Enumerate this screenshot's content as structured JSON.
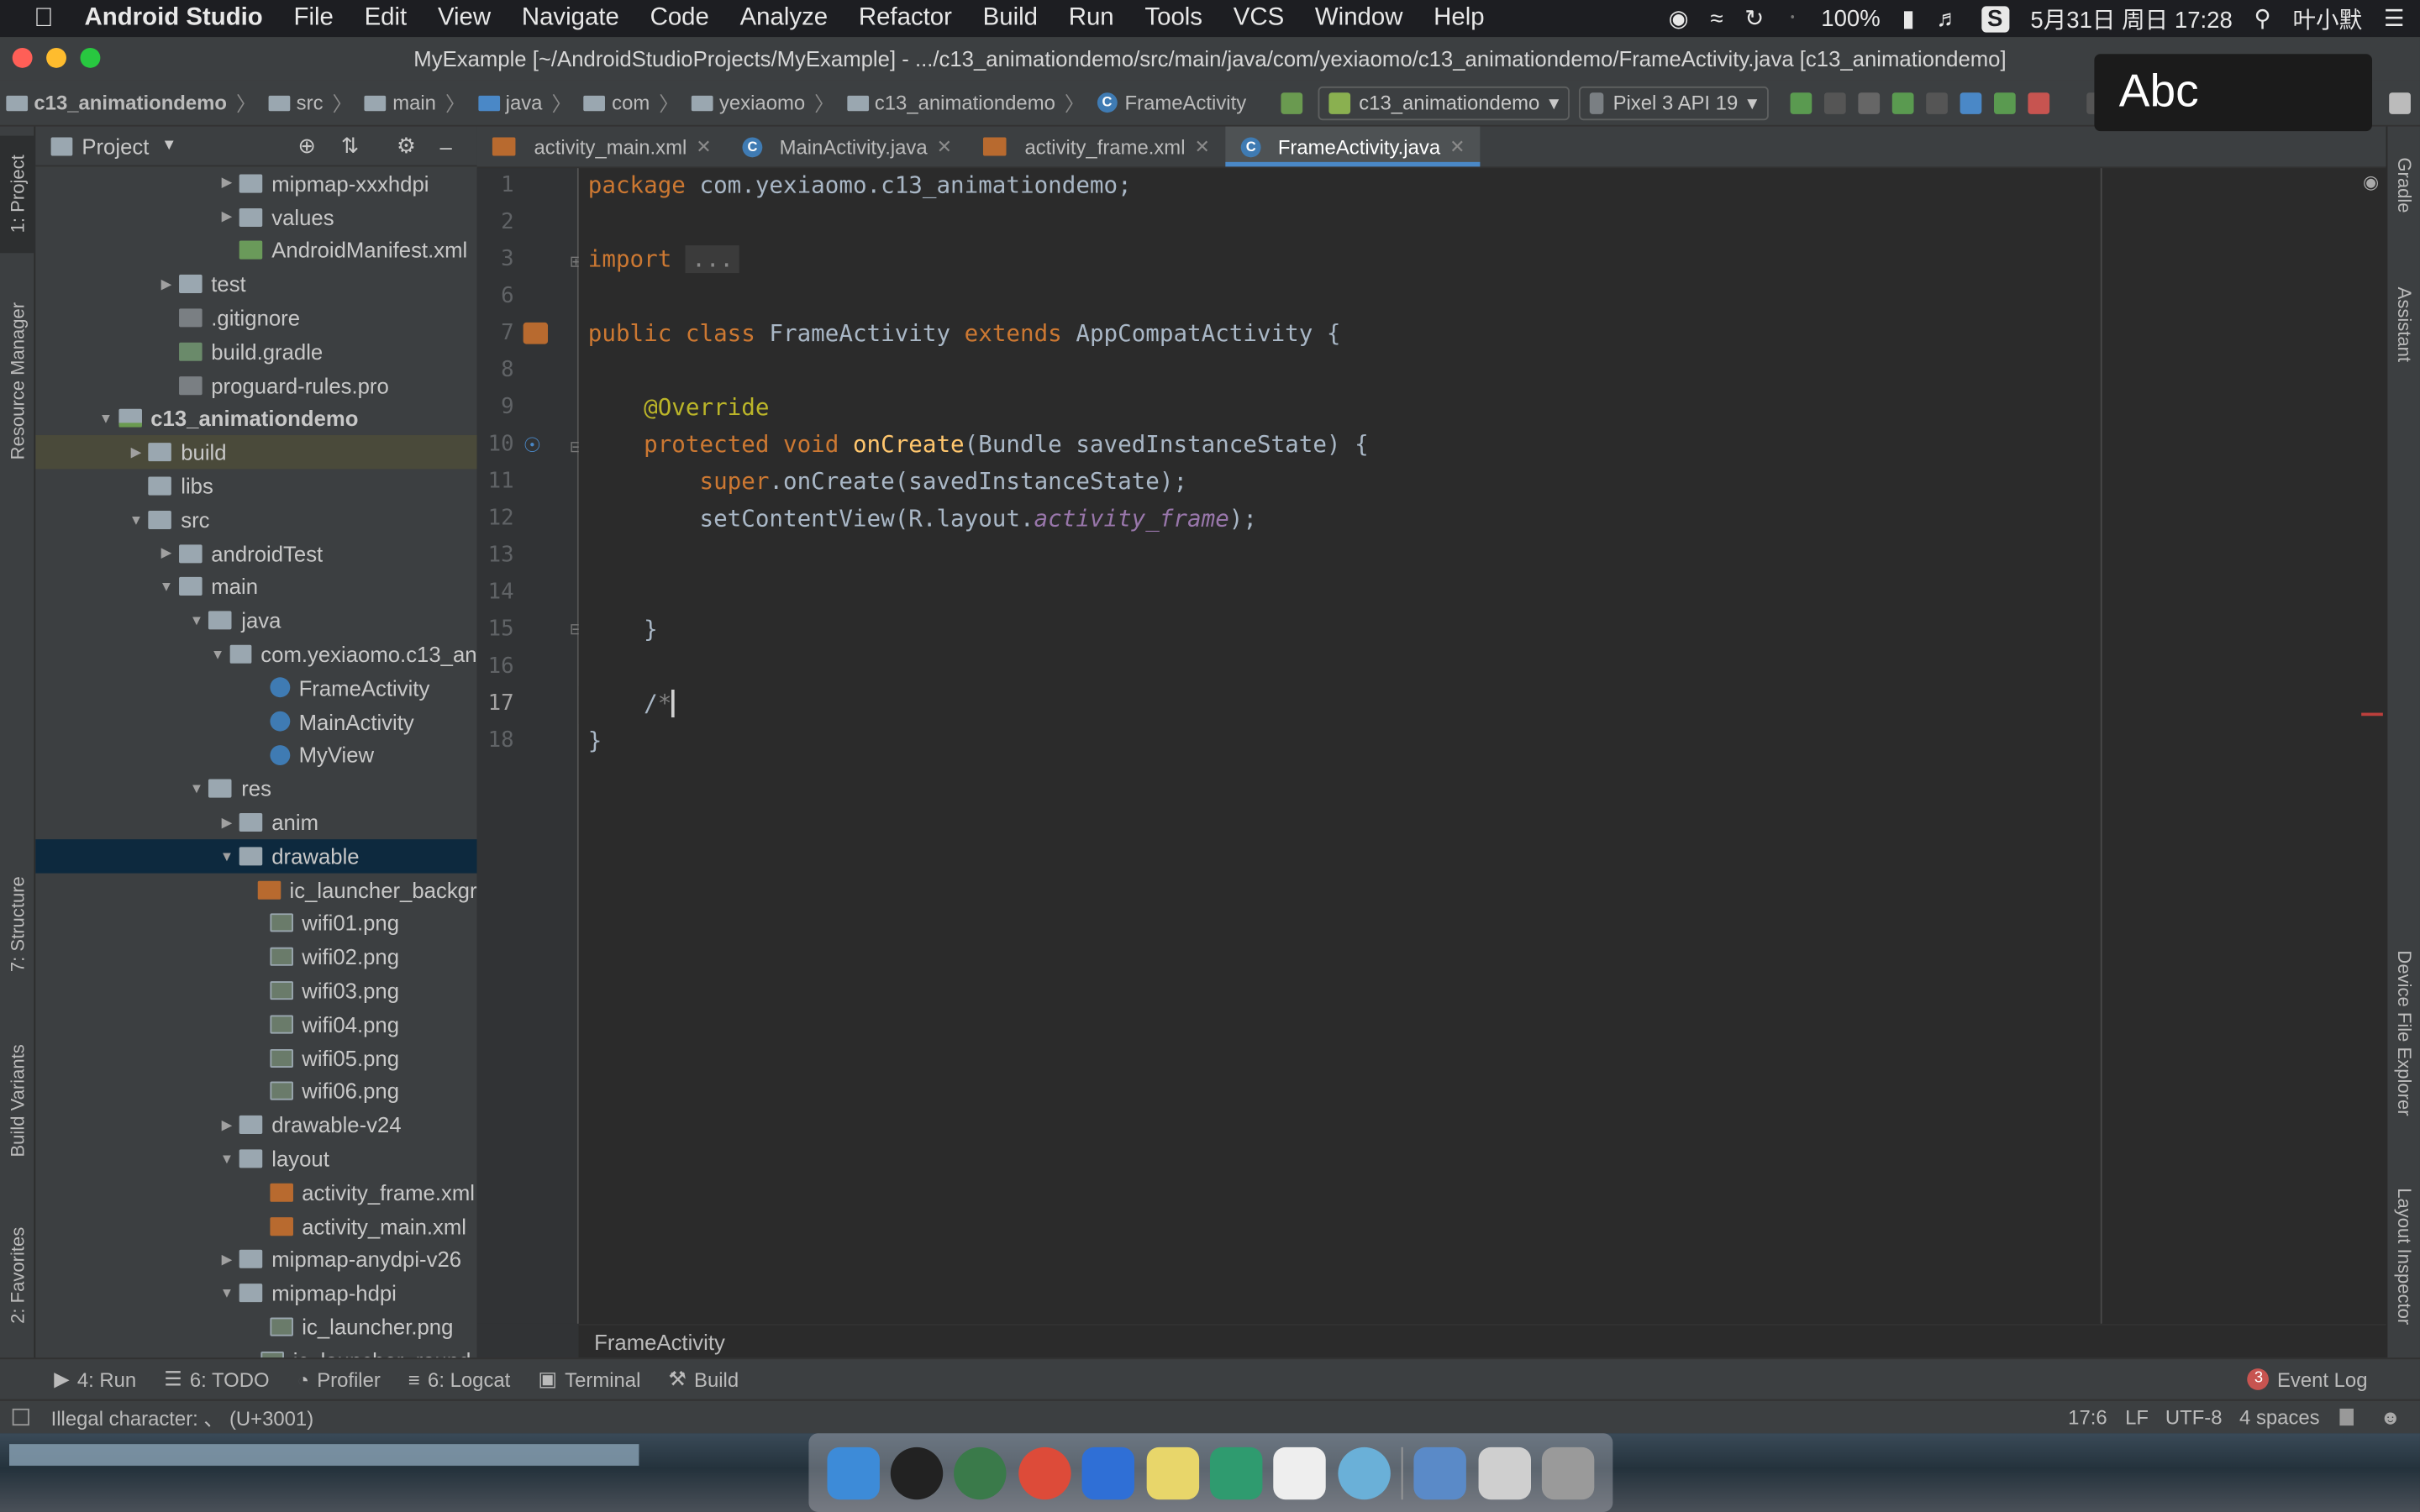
{
  "menubar": {
    "apple": "",
    "app": "Android Studio",
    "items": [
      "File",
      "Edit",
      "View",
      "Navigate",
      "Code",
      "Analyze",
      "Refactor",
      "Build",
      "Run",
      "Tools",
      "VCS",
      "Window",
      "Help"
    ],
    "battery": "100%",
    "datetime": "5月31日 周日 17:28",
    "user": "叶小默"
  },
  "window": {
    "title": "MyExample [~/AndroidStudioProjects/MyExample] - .../c13_animationdemo/src/main/java/com/yexiaomo/c13_animationdemo/FrameActivity.java [c13_animationdemo]"
  },
  "navbar": {
    "crumbs": [
      "c13_animationdemo",
      "src",
      "main",
      "java",
      "com",
      "yexiaomo",
      "c13_animationdemo",
      "FrameActivity"
    ],
    "run_config": "c13_animationdemo",
    "device": "Pixel 3 API 19"
  },
  "project_panel": {
    "title": "Project",
    "rows": [
      {
        "label": "mipmap-xxxhdpi",
        "indent": 5,
        "arrow": "right",
        "icon": "folder"
      },
      {
        "label": "values",
        "indent": 5,
        "arrow": "right",
        "icon": "folder"
      },
      {
        "label": "AndroidManifest.xml",
        "indent": 5,
        "arrow": "",
        "icon": "manifest"
      },
      {
        "label": "test",
        "indent": 3,
        "arrow": "right",
        "icon": "folder"
      },
      {
        "label": ".gitignore",
        "indent": 3,
        "arrow": "",
        "icon": "file"
      },
      {
        "label": "build.gradle",
        "indent": 3,
        "arrow": "",
        "icon": "gradle"
      },
      {
        "label": "proguard-rules.pro",
        "indent": 3,
        "arrow": "",
        "icon": "file"
      },
      {
        "label": "c13_animationdemo",
        "indent": 1,
        "arrow": "down",
        "icon": "modfolder",
        "bold": true
      },
      {
        "label": "build",
        "indent": 2,
        "arrow": "right",
        "icon": "folder",
        "build": true
      },
      {
        "label": "libs",
        "indent": 2,
        "arrow": "",
        "icon": "folder"
      },
      {
        "label": "src",
        "indent": 2,
        "arrow": "down",
        "icon": "folder"
      },
      {
        "label": "androidTest",
        "indent": 3,
        "arrow": "right",
        "icon": "folder"
      },
      {
        "label": "main",
        "indent": 3,
        "arrow": "down",
        "icon": "folder"
      },
      {
        "label": "java",
        "indent": 4,
        "arrow": "down",
        "icon": "folder"
      },
      {
        "label": "com.yexiaomo.c13_an",
        "indent": 5,
        "arrow": "down",
        "icon": "folder"
      },
      {
        "label": "FrameActivity",
        "indent": 6,
        "arrow": "",
        "icon": "class"
      },
      {
        "label": "MainActivity",
        "indent": 6,
        "arrow": "",
        "icon": "class"
      },
      {
        "label": "MyView",
        "indent": 6,
        "arrow": "",
        "icon": "class"
      },
      {
        "label": "res",
        "indent": 4,
        "arrow": "down",
        "icon": "folder"
      },
      {
        "label": "anim",
        "indent": 5,
        "arrow": "right",
        "icon": "folder"
      },
      {
        "label": "drawable",
        "indent": 5,
        "arrow": "down",
        "icon": "folder",
        "selected": true
      },
      {
        "label": "ic_launcher_backgr",
        "indent": 6,
        "arrow": "",
        "icon": "xml"
      },
      {
        "label": "wifi01.png",
        "indent": 6,
        "arrow": "",
        "icon": "png"
      },
      {
        "label": "wifi02.png",
        "indent": 6,
        "arrow": "",
        "icon": "png"
      },
      {
        "label": "wifi03.png",
        "indent": 6,
        "arrow": "",
        "icon": "png"
      },
      {
        "label": "wifi04.png",
        "indent": 6,
        "arrow": "",
        "icon": "png"
      },
      {
        "label": "wifi05.png",
        "indent": 6,
        "arrow": "",
        "icon": "png"
      },
      {
        "label": "wifi06.png",
        "indent": 6,
        "arrow": "",
        "icon": "png"
      },
      {
        "label": "drawable-v24",
        "indent": 5,
        "arrow": "right",
        "icon": "folder"
      },
      {
        "label": "layout",
        "indent": 5,
        "arrow": "down",
        "icon": "folder"
      },
      {
        "label": "activity_frame.xml",
        "indent": 6,
        "arrow": "",
        "icon": "xml"
      },
      {
        "label": "activity_main.xml",
        "indent": 6,
        "arrow": "",
        "icon": "xml"
      },
      {
        "label": "mipmap-anydpi-v26",
        "indent": 5,
        "arrow": "right",
        "icon": "folder"
      },
      {
        "label": "mipmap-hdpi",
        "indent": 5,
        "arrow": "down",
        "icon": "folder"
      },
      {
        "label": "ic_launcher.png",
        "indent": 6,
        "arrow": "",
        "icon": "png"
      },
      {
        "label": "ic_launcher_round.",
        "indent": 6,
        "arrow": "",
        "icon": "png"
      }
    ]
  },
  "left_stripe": [
    "1: Project",
    "Resource Manager",
    "7: Structure",
    "Build Variants",
    "2: Favorites"
  ],
  "right_stripe": [
    "Gradle",
    "Assistant",
    "Device File Explorer",
    "Layout Inspector"
  ],
  "tabs": [
    {
      "label": "activity_main.xml",
      "icon": "xml",
      "active": false
    },
    {
      "label": "MainActivity.java",
      "icon": "class",
      "active": false
    },
    {
      "label": "activity_frame.xml",
      "icon": "xml",
      "active": false
    },
    {
      "label": "FrameActivity.java",
      "icon": "class",
      "active": true
    }
  ],
  "editor": {
    "line_numbers": [
      "1",
      "2",
      "3",
      "6",
      "7",
      "8",
      "9",
      "10",
      "11",
      "12",
      "13",
      "14",
      "15",
      "16",
      "17",
      "18"
    ],
    "current_line": "17",
    "breadcrumb": "FrameActivity"
  },
  "tool_tabs": [
    {
      "label": "4: Run",
      "icon": "run-icon"
    },
    {
      "label": "6: TODO",
      "icon": "todo-icon"
    },
    {
      "label": "Profiler",
      "icon": "profiler-icon"
    },
    {
      "label": "6: Logcat",
      "icon": "logcat-icon"
    },
    {
      "label": "Terminal",
      "icon": "terminal-icon"
    },
    {
      "label": "Build",
      "icon": "build-icon"
    }
  ],
  "event_log": {
    "count": "3",
    "label": "Event Log"
  },
  "status": {
    "message": "Illegal character: 、 (U+3001)",
    "position": "17:6",
    "line_sep": "LF",
    "encoding": "UTF-8",
    "indent": "4 spaces"
  },
  "overlay": {
    "text": "Abc"
  },
  "colors": {
    "accent": "#4a88c7",
    "keyword": "#cc7832",
    "annotation": "#bbb529",
    "function": "#ffc66d",
    "field": "#9876aa"
  }
}
